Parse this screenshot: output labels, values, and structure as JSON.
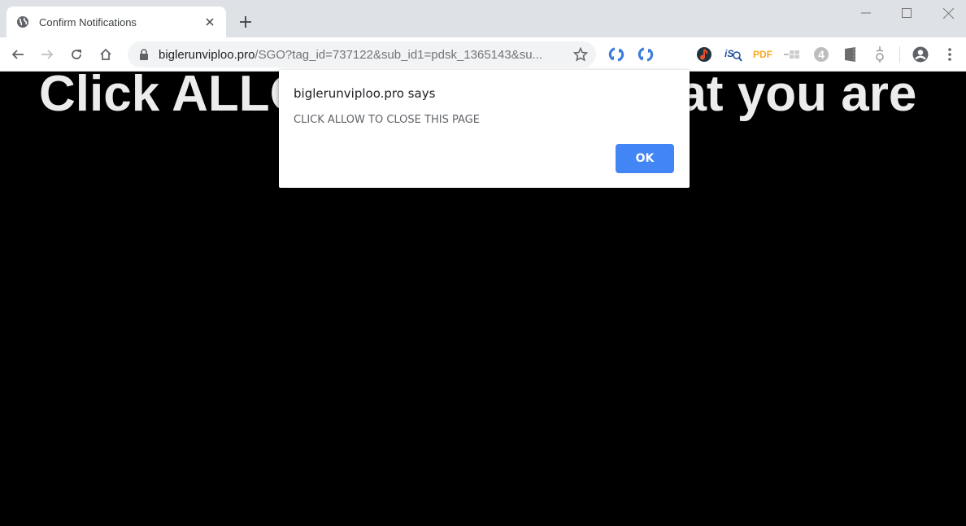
{
  "tab": {
    "title": "Confirm Notifications",
    "icon": "globe-icon"
  },
  "omnibox": {
    "domain": "biglerunviploo.pro",
    "path": "/SGO?tag_id=737122&sub_id1=pdsk_1365143&su..."
  },
  "extensions": [
    {
      "name": "sync-extension-icon"
    },
    {
      "name": "sync-extension-icon-2"
    },
    {
      "name": "music-extension-icon"
    },
    {
      "name": "iso-search-extension-icon"
    },
    {
      "name": "pdf-extension-icon",
      "label": "PDF"
    },
    {
      "name": "grid-extension-icon"
    },
    {
      "name": "number-four-extension-icon",
      "label": "4"
    },
    {
      "name": "film-extension-icon"
    },
    {
      "name": "ornament-extension-icon"
    }
  ],
  "page": {
    "headline": "Click ALLOW to confirm that you are"
  },
  "dialog": {
    "title": "biglerunviploo.pro says",
    "message": "CLICK ALLOW TO CLOSE THIS PAGE",
    "ok_label": "OK"
  },
  "colors": {
    "accent": "#4285f4",
    "pdf": "#f9a825",
    "sync": "#3b7ddd"
  }
}
